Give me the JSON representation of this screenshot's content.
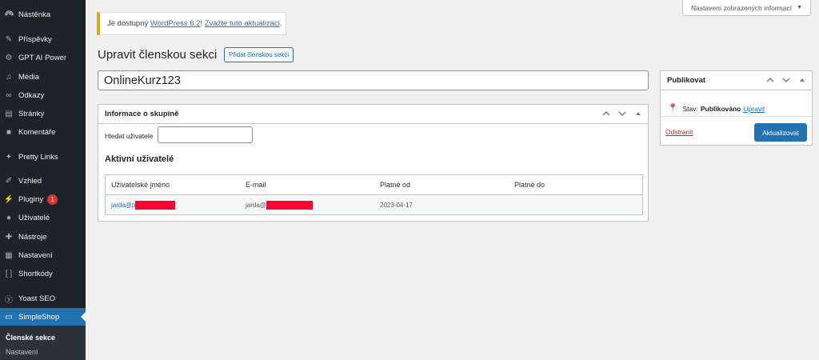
{
  "sidebar": {
    "items": [
      {
        "label": "Nástěnka",
        "icon": "dashboard-icon"
      },
      {
        "label": "Příspěvky",
        "icon": "pin-icon"
      },
      {
        "label": "GPT AI Power",
        "icon": "gear-icon"
      },
      {
        "label": "Média",
        "icon": "media-icon"
      },
      {
        "label": "Odkazy",
        "icon": "link-icon"
      },
      {
        "label": "Stránky",
        "icon": "pages-icon"
      },
      {
        "label": "Komentáře",
        "icon": "comment-icon"
      },
      {
        "label": "Pretty Links",
        "icon": "star-icon"
      },
      {
        "label": "Vzhled",
        "icon": "brush-icon"
      },
      {
        "label": "Pluginy",
        "icon": "plugin-icon",
        "badge": "1"
      },
      {
        "label": "Uživatelé",
        "icon": "user-icon"
      },
      {
        "label": "Nástroje",
        "icon": "wrench-icon"
      },
      {
        "label": "Nastavení",
        "icon": "settings-icon"
      },
      {
        "label": "Shortkódy",
        "icon": "brackets-icon"
      },
      {
        "label": "Yoast SEO",
        "icon": "yoast-icon"
      },
      {
        "label": "SimpleShop",
        "icon": "shop-icon"
      }
    ],
    "submenu": {
      "current": "Členské sekce",
      "other": "Nastavení"
    }
  },
  "screen_options": {
    "label": "Nastavení zobrazených informací"
  },
  "notice": {
    "prefix": "Je dostupný ",
    "link1": "WordPress 6.2",
    "middle": "! ",
    "link2": "Zvažte tuto aktualizaci",
    "suffix": "."
  },
  "page": {
    "title": "Upravit členskou sekci",
    "add_button": "Přidat členskou sekci",
    "post_title": "OnlineKurz123"
  },
  "group_box": {
    "title": "Informace o skupině",
    "search_label": "Hledat uživatele",
    "active_users_heading": "Aktivní uživatelé",
    "columns": [
      "Uživatelské jméno",
      "E-mail",
      "Platné od",
      "Platné do"
    ],
    "rows": [
      {
        "username": "jarda@p",
        "email": "jarda@",
        "valid_from": "2023-04-17",
        "valid_to": ""
      }
    ]
  },
  "publish": {
    "title": "Publikovat",
    "status_label": "Stav:",
    "status_value": "Publikováno",
    "edit_link": "Upravit",
    "delete_link": "Odstranit",
    "update_button": "Aktualizovat"
  },
  "colors": {
    "accent": "#2271b1",
    "sidebar": "#1d2327",
    "notice_warning": "#dba617",
    "badge": "#d63638",
    "redaction": "#ff0033"
  }
}
